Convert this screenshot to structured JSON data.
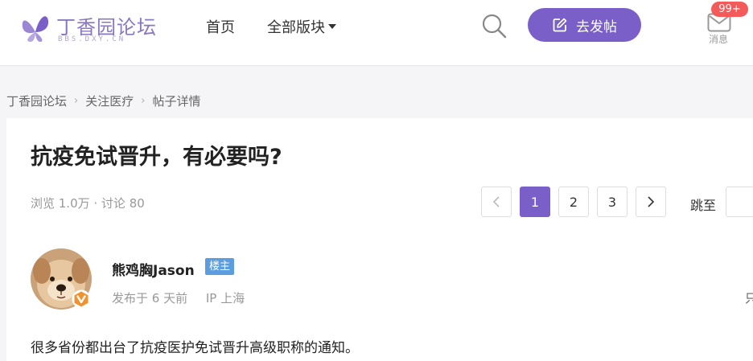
{
  "header": {
    "logo_cn": "丁香园论坛",
    "logo_en": "BBS.DXY.CN",
    "nav_home": "首页",
    "nav_all": "全部版块",
    "post_button": "去发帖",
    "message_label": "消息",
    "message_badge": "99+",
    "accent_color": "#7a5fc8"
  },
  "breadcrumb": [
    "丁香园论坛",
    "关注医疗",
    "帖子详情"
  ],
  "post": {
    "title": "抗疫免试晋升，有必要吗?",
    "stats": "浏览 1.0万 · 讨论 80",
    "author": "熊鸡胸Jason",
    "owner_tag": "楼主",
    "posted": "发布于 6 天前",
    "ip": "IP 上海",
    "only_view": "只",
    "content": "很多省份都出台了抗疫医护免试晋升高级职称的通知。"
  },
  "pagination": {
    "pages": [
      "1",
      "2",
      "3"
    ],
    "current": "1",
    "jump_label": "跳至"
  }
}
